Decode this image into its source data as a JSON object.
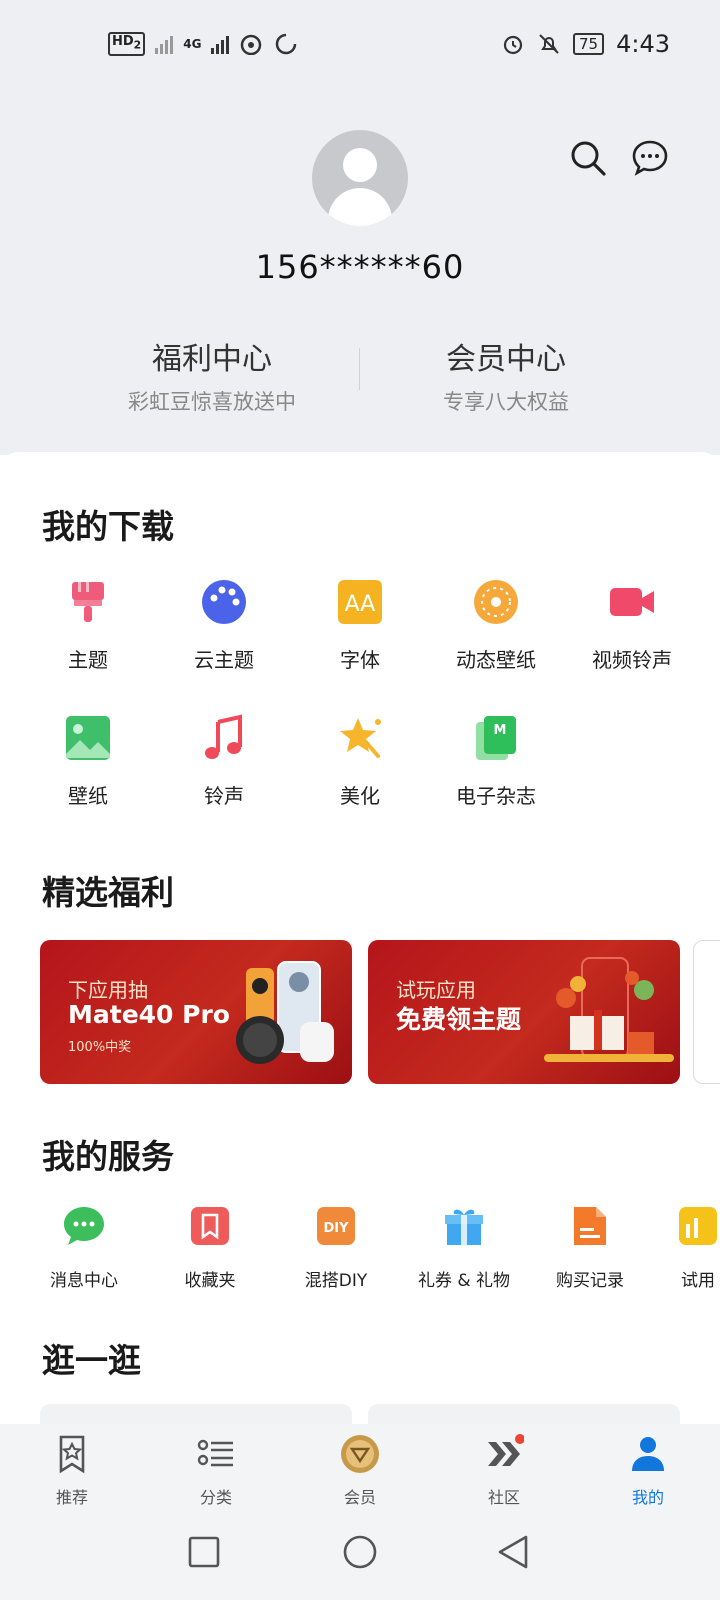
{
  "status_bar": {
    "left": {
      "hd": "HD",
      "hd_sub": "2",
      "net": "4G"
    },
    "battery": "75",
    "time": "4:43"
  },
  "header": {
    "phone": "156******60"
  },
  "quick_links": [
    {
      "title": "福利中心",
      "subtitle": "彩虹豆惊喜放送中"
    },
    {
      "title": "会员中心",
      "subtitle": "专享八大权益"
    }
  ],
  "downloads": {
    "title": "我的下载",
    "items": [
      {
        "label": "主题",
        "icon": "brush-icon"
      },
      {
        "label": "云主题",
        "icon": "palette-icon"
      },
      {
        "label": "字体",
        "icon": "font-icon"
      },
      {
        "label": "动态壁纸",
        "icon": "live-wallpaper-icon"
      },
      {
        "label": "视频铃声",
        "icon": "video-icon"
      },
      {
        "label": "壁纸",
        "icon": "image-icon"
      },
      {
        "label": "铃声",
        "icon": "music-icon"
      },
      {
        "label": "美化",
        "icon": "star-icon"
      },
      {
        "label": "电子杂志",
        "icon": "magazine-icon"
      }
    ]
  },
  "benefits": {
    "title": "精选福利",
    "banners": [
      {
        "line1": "下应用抽",
        "line2": "Mate40 Pro",
        "line3": "100%中奖"
      },
      {
        "line1": "试玩应用",
        "line2": "免费领主题"
      }
    ]
  },
  "services": {
    "title": "我的服务",
    "items": [
      {
        "label": "消息中心",
        "icon": "chat-bubble-icon"
      },
      {
        "label": "收藏夹",
        "icon": "bookmark-icon"
      },
      {
        "label": "混搭DIY",
        "icon": "diy-icon"
      },
      {
        "label": "礼券 & 礼物",
        "icon": "gift-icon"
      },
      {
        "label": "购买记录",
        "icon": "receipt-icon"
      },
      {
        "label": "试用",
        "icon": "trial-icon"
      }
    ]
  },
  "browse": {
    "title": "逛一逛"
  },
  "bottom_nav": [
    {
      "label": "推荐",
      "icon": "star-bookmark-icon"
    },
    {
      "label": "分类",
      "icon": "list-icon"
    },
    {
      "label": "会员",
      "icon": "vip-badge-icon"
    },
    {
      "label": "社区",
      "icon": "community-icon"
    },
    {
      "label": "我的",
      "icon": "person-icon",
      "active": true
    }
  ],
  "colors": {
    "accent": "#1177dd",
    "banner_red": "#b5151b",
    "header_bg": "#edeff2"
  }
}
